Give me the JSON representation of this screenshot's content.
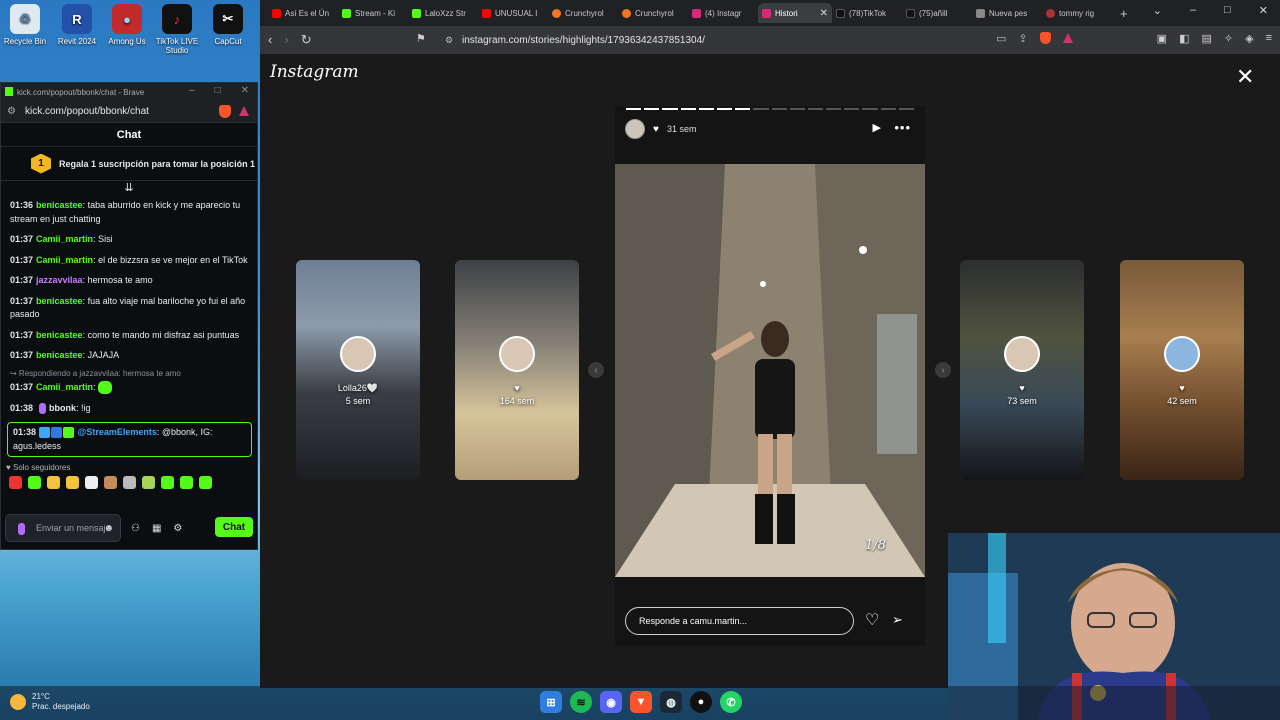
{
  "desktop": {
    "icons": [
      {
        "label": "Recycle Bin",
        "color": "#dfe9f2",
        "glyph": "♻"
      },
      {
        "label": "Revit 2024",
        "color": "#2350a8",
        "glyph": "R"
      },
      {
        "label": "Among Us",
        "color": "#c22b2b",
        "glyph": "●"
      },
      {
        "label": "TikTok LIVE Studio",
        "color": "#111111",
        "glyph": "♪"
      },
      {
        "label": "CapCut",
        "color": "#111111",
        "glyph": "✂"
      }
    ],
    "weather": {
      "temp": "21°C",
      "desc": "Prac. despejado"
    }
  },
  "chat_window": {
    "title": "kick.com/popout/bbonk/chat - Brave",
    "url": "kick.com/popout/bbonk/chat",
    "header": "Chat",
    "sub_badge": "1",
    "sub_banner": "Regala 1 suscripción para tomar la posición 1",
    "pin_icon": "⇊",
    "messages": [
      {
        "time": "01:36",
        "user": "benicastee",
        "text": "taba aburrido en kick y me aparecio tu stream en just chatting"
      },
      {
        "time": "01:37",
        "user": "Camii_martin",
        "text": "Sisi"
      },
      {
        "time": "01:37",
        "user": "Camii_martin",
        "text": "el de bizzsra se ve mejor en el TikTok"
      },
      {
        "time": "01:37",
        "user": "jazzavvilaa",
        "text": "hermosa te amo"
      },
      {
        "time": "01:37",
        "user": "benicastee",
        "text": "fua alto viaje mal bariloche yo fui el año pasado"
      },
      {
        "time": "01:37",
        "user": "benicastee",
        "text": "como te mando mi disfraz asi puntuas"
      },
      {
        "time": "01:37",
        "user": "benicastee",
        "text": "JAJAJA"
      }
    ],
    "reply_note": "↪ Respondiendo a jazzavvilaa: hermosa te amo",
    "reply_msg": {
      "time": "01:37",
      "user": "Camii_martin"
    },
    "mic_msg": {
      "time": "01:38",
      "user": "bbonk",
      "text": "!ig"
    },
    "highlight_msg": {
      "time": "01:38",
      "user": "@StreamElements",
      "text": "@bbonk, IG: agus.ledess"
    },
    "followers_only": "Solo seguidores",
    "input_placeholder": "Enviar un mensaje",
    "send_label": "Chat"
  },
  "browser": {
    "tabs": [
      {
        "label": "Así Es el Ún",
        "color": "#ff0000"
      },
      {
        "label": "Stream - Ki",
        "color": "#53fc18"
      },
      {
        "label": "LaloXzz Str",
        "color": "#53fc18"
      },
      {
        "label": "UNUSUAL I",
        "color": "#ff0000"
      },
      {
        "label": "Crunchyrol",
        "color": "#f47521"
      },
      {
        "label": "Crunchyrol",
        "color": "#f47521"
      },
      {
        "label": "(4) Instagr",
        "color": "#d62976"
      },
      {
        "label": "Histori",
        "color": "#d62976"
      },
      {
        "label": "(78)TikTok",
        "color": "#111111"
      },
      {
        "label": "(75)añill",
        "color": "#111111"
      },
      {
        "label": "Nueva pes",
        "color": "#888888"
      },
      {
        "label": "tommy rig",
        "color": "#aa3333"
      }
    ],
    "active_tab": 7,
    "url": "instagram.com/stories/highlights/17936342437851304/"
  },
  "instagram": {
    "logo": "Instagram",
    "side_cards": [
      {
        "name": "Lolla26🤍",
        "time": "5 sem",
        "bg": "linear-gradient(180deg,#6d7f95 0%,#8d9bab 30%,#3b3f44 60%,#1c1e22 100%)"
      },
      {
        "name": "",
        "time": "164 sem",
        "bg": "linear-gradient(180deg,#3d4146 0%,#8a8478 40%,#d6c49b 70%,#b59e78 100%)"
      },
      {
        "name": "",
        "time": "73 sem",
        "bg": "linear-gradient(180deg,#2c2e30 0%,#50533f 35%,#3a4a58 65%,#141518 100%)"
      },
      {
        "name": "",
        "time": "42 sem",
        "bg": "linear-gradient(180deg,#7a5a3a 0%,#a77e4f 35%,#6d4a2c 70%,#3a2416 100%)"
      }
    ],
    "story": {
      "segments_total": 16,
      "segments_done": 7,
      "time_ago": "31 sem",
      "counter": "1/8",
      "reply_placeholder": "Responde a camu.martin..."
    }
  }
}
